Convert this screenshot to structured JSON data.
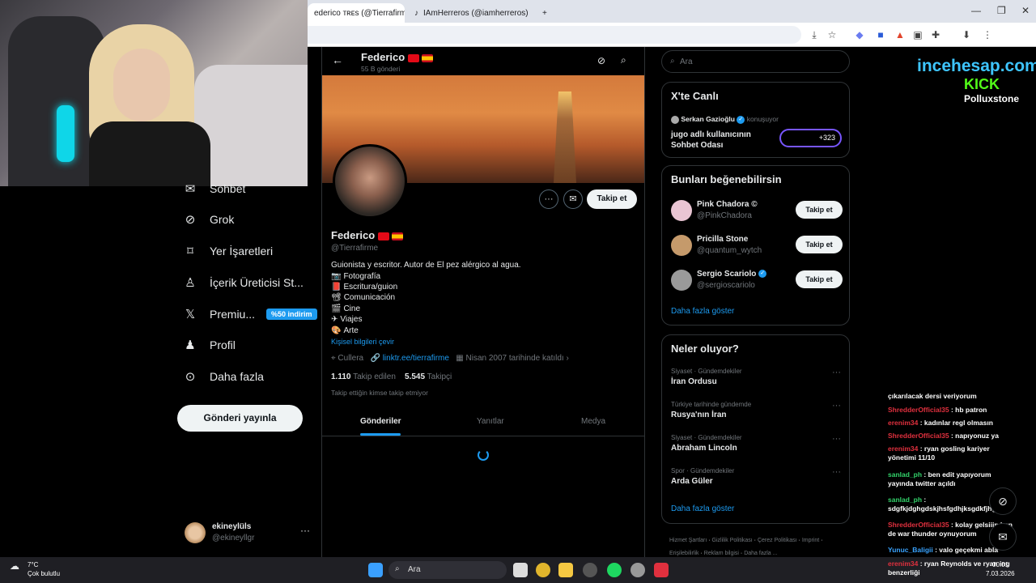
{
  "browser": {
    "tabs": [
      {
        "label": "ederico ᴛʀᴇs (@Tierrafirme)",
        "active": true
      },
      {
        "label": "IAmHerreros (@iamherreros) | T",
        "active": false
      }
    ],
    "new_tab_label": "+"
  },
  "sidebar": {
    "items": [
      {
        "label": "Sohbet",
        "icon": "mail-icon"
      },
      {
        "label": "Grok",
        "icon": "grok-icon"
      },
      {
        "label": "Yer İşaretleri",
        "icon": "bookmark-icon"
      },
      {
        "label": "İçerik Üreticisi St...",
        "icon": "creator-icon"
      },
      {
        "label": "Premiu...",
        "icon": "x-logo-icon"
      },
      {
        "label": "Profil",
        "icon": "profile-icon"
      },
      {
        "label": "Daha fazla",
        "icon": "more-icon"
      }
    ],
    "premium_badge": "%50 indirim",
    "post_button": "Gönderi yayınla",
    "account": {
      "name": "ekineylüls",
      "handle": "@ekineyllgr"
    }
  },
  "profile": {
    "header_name": "Federico",
    "post_count": "55 B gönderi",
    "name": "Federico",
    "handle": "@Tierrafirme",
    "follow_label": "Takip et",
    "bio": "Guionista y escritor.  Autor de El pez alérgico al agua.",
    "bio_items": [
      "Fotografía",
      "Escritura/guion",
      "Comunicación",
      "Cine",
      "Viajes",
      "Arte"
    ],
    "translate_link": "Kişisel bilgileri çevir",
    "location": "Cullera",
    "website": "linktr.ee/tierrafirme",
    "joined": "Nisan 2007 tarihinde katıldı",
    "following_count": "1.110",
    "following_label": "Takip edilen",
    "followers_count": "5.545",
    "followers_label": "Takipçi",
    "not_followed": "Takip ettiğin kimse takip etmiyor",
    "tabs": [
      "Gönderiler",
      "Yanıtlar",
      "Medya"
    ]
  },
  "right": {
    "search_placeholder": "Ara",
    "live": {
      "title": "X'te Canlı",
      "host": "Serkan Gazioğlu",
      "status": "konuşuyor",
      "room": "jugo adlı kullanıcının Sohbet Odası",
      "count": "+323"
    },
    "suggestions": {
      "title": "Bunları beğenebilirsin",
      "items": [
        {
          "name": "Pink Chadora ©",
          "handle": "@PinkChadora",
          "button": "Takip et"
        },
        {
          "name": "Pricilla Stone",
          "handle": "@quantum_wytch",
          "button": "Takip et"
        },
        {
          "name": "Sergio Scariolo",
          "handle": "@sergioscariolo",
          "button": "Takip et"
        }
      ],
      "more": "Daha fazla göster"
    },
    "trends": {
      "title": "Neler oluyor?",
      "items": [
        {
          "category": "Siyaset · Gündemdekiler",
          "topic": "İran Ordusu"
        },
        {
          "category": "Türkiye tarihinde gündemde",
          "topic": "Rusya'nın İran"
        },
        {
          "category": "Siyaset · Gündemdekiler",
          "topic": "Abraham Lincoln"
        },
        {
          "category": "Spor · Gündemdekiler",
          "topic": "Arda Güler"
        }
      ],
      "more": "Daha fazla göster"
    },
    "footer": [
      "Hizmet Şartları",
      "Gizlilik Politikası",
      "Çerez Politikası",
      "Imprint",
      "Erişilebilirlik",
      "Reklam bilgisi",
      "Daha fazla ..."
    ]
  },
  "overlay": {
    "brand": "incehesap.com",
    "kick": "KICK",
    "channel": "Polluxstone",
    "chat": [
      {
        "user": "",
        "text": "çıkarılacak dersi veriyorum",
        "color": "white"
      },
      {
        "user": "ShredderOfficial35",
        "text": " : hb patron",
        "color": "red"
      },
      {
        "user": "erenim34",
        "text": " : kadınlar regl olmasın",
        "color": "red"
      },
      {
        "user": "ShredderOfficial35",
        "text": " : napıyonuz ya",
        "color": "red"
      },
      {
        "user": "erenim34",
        "text": " : ryan gosling kariyer yönetimi 11/10",
        "color": "red"
      },
      {
        "user": "sanlad_ph",
        "text": " : ben edit yapıyorum yayında twitter açıldı",
        "color": "green"
      },
      {
        "user": "sanlad_ph",
        "text": " : sdgfkjdghgdskjhsfgdhjksgdkfjhgsdf",
        "color": "green"
      },
      {
        "user": "ShredderOfficial35",
        "text": " : kolay gelsiiin ben de war thunder oynuyorum",
        "color": "red"
      },
      {
        "user": "Yunuc_Baligii",
        "text": " : valo geçekmi abla",
        "color": "blue"
      },
      {
        "user": "erenim34",
        "text": " : ryan Reynolds ve ryan ing benzerliği",
        "color": "red"
      }
    ]
  },
  "taskbar": {
    "weather_temp": "7°C",
    "weather_desc": "Çok bulutlu",
    "search": "Ara",
    "time": "00:01",
    "date": "7.03.2026"
  },
  "colors": {
    "accent": "#1d9bf0",
    "bg": "#000000",
    "muted": "#71767b",
    "border": "#2f3336"
  }
}
